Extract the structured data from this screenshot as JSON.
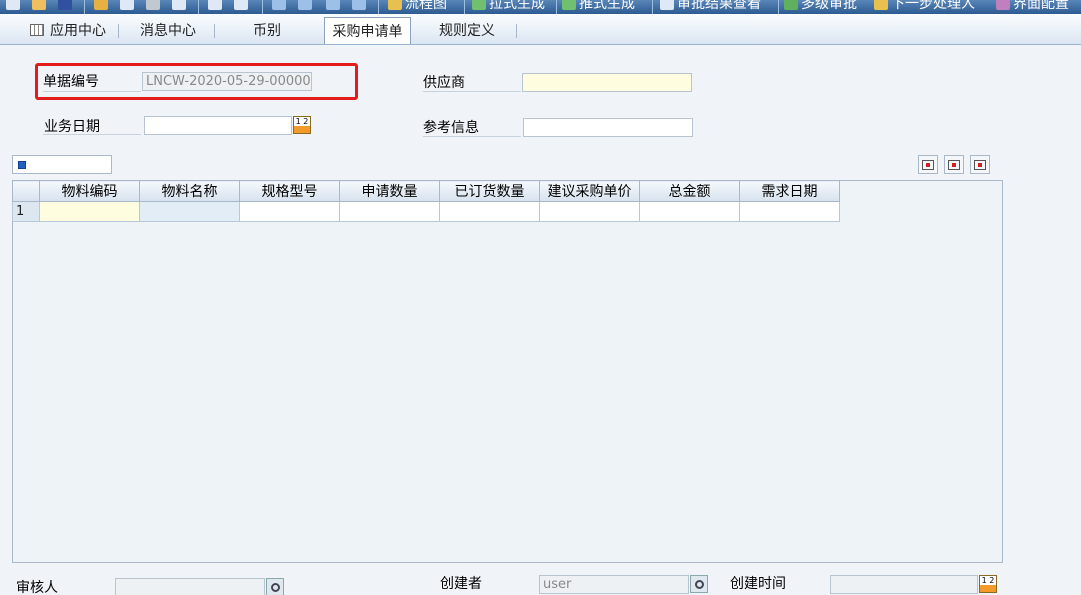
{
  "toolbar": {
    "items": [
      {
        "label": "流程图",
        "icon": "flowchart-icon"
      },
      {
        "label": "拉式生成",
        "icon": "pull-generate-icon"
      },
      {
        "label": "推式生成",
        "icon": "push-generate-icon"
      },
      {
        "label": "审批结果查看",
        "icon": "approval-result-icon"
      },
      {
        "label": "多级审批",
        "icon": "multi-approval-icon"
      },
      {
        "label": "下一步处理人",
        "icon": "next-handler-icon"
      },
      {
        "label": "界面配置",
        "icon": "ui-config-icon"
      }
    ]
  },
  "tabs": [
    {
      "label": "应用中心",
      "icon": "grid-icon"
    },
    {
      "label": "消息中心"
    },
    {
      "label": "币别"
    },
    {
      "label": "采购申请单",
      "active": true
    },
    {
      "label": "规则定义"
    }
  ],
  "form": {
    "doc_no_label": "单据编号",
    "doc_no_value": "LNCW-2020-05-29-00000",
    "supplier_label": "供应商",
    "supplier_value": "",
    "biz_date_label": "业务日期",
    "biz_date_value": "",
    "ref_info_label": "参考信息",
    "ref_info_value": "",
    "calendar_glyph": "1 2"
  },
  "table": {
    "columns": [
      "物料编码",
      "物料名称",
      "规格型号",
      "申请数量",
      "已订货数量",
      "建议采购单价",
      "总金额",
      "需求日期"
    ],
    "rows": [
      {
        "num": "1",
        "cells": [
          "",
          "",
          "",
          "",
          "",
          "",
          "",
          ""
        ]
      }
    ]
  },
  "footer": {
    "reviewer_label": "审核人",
    "reviewer_value": "",
    "creator_label": "创建者",
    "creator_value": "user",
    "created_time_label": "创建时间",
    "created_time_value": ""
  },
  "colors": {
    "highlight_border": "#e21b1b",
    "required_field": "#fffde0",
    "toolbar": "#2c5b92"
  }
}
